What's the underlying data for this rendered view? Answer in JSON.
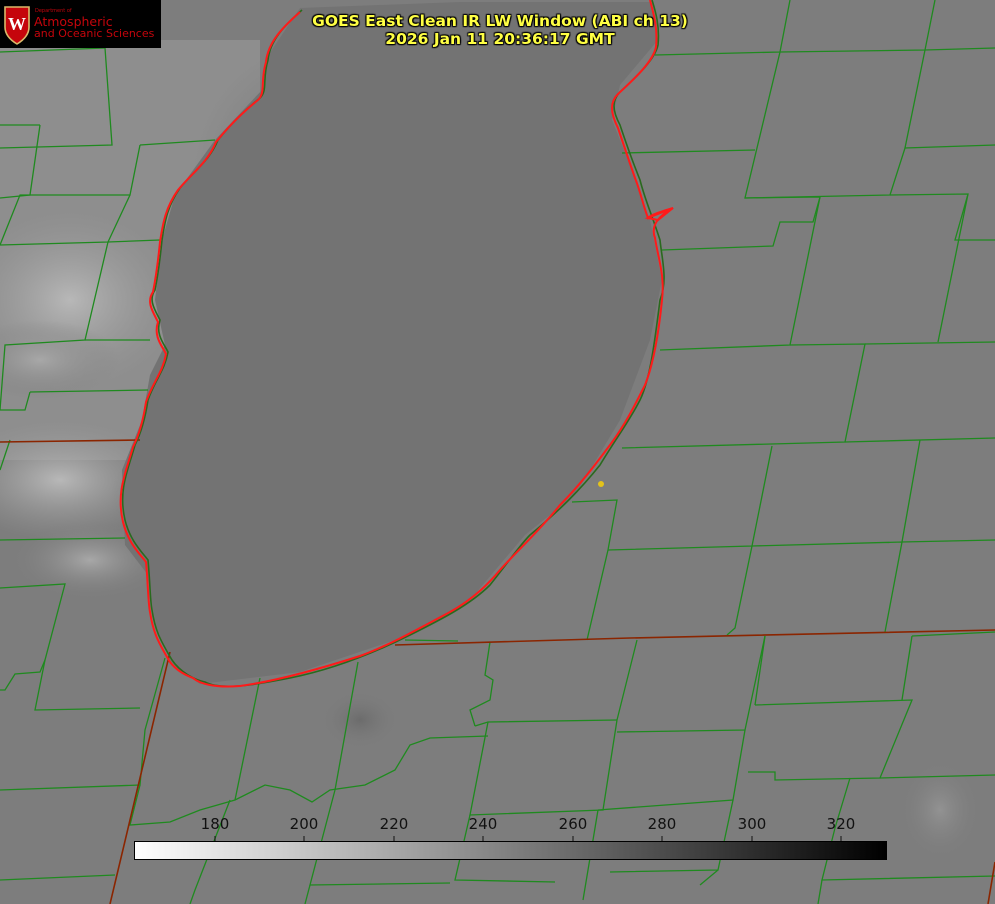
{
  "title": {
    "line1": "GOES East Clean IR LW Window (ABI ch 13)",
    "line2": "2026 Jan 11 20:36:17 GMT"
  },
  "logo": {
    "department": "Department of",
    "line1": "Atmospheric",
    "line2": "and Oceanic Sciences",
    "crest_letter": "W"
  },
  "colorbar": {
    "tick_labels": [
      "180",
      "200",
      "220",
      "240",
      "260",
      "280",
      "300",
      "320"
    ],
    "colors": {
      "start": "#ffffff",
      "end": "#000000"
    }
  },
  "colors": {
    "background": "#7d7d7d",
    "county_lines": "#1f8a1f",
    "state_lines": "#8b2500",
    "lake_shore": "#ff1a1a",
    "marker": "#e3c21a",
    "title": "#ffff44",
    "logo_red": "#c5050c"
  }
}
